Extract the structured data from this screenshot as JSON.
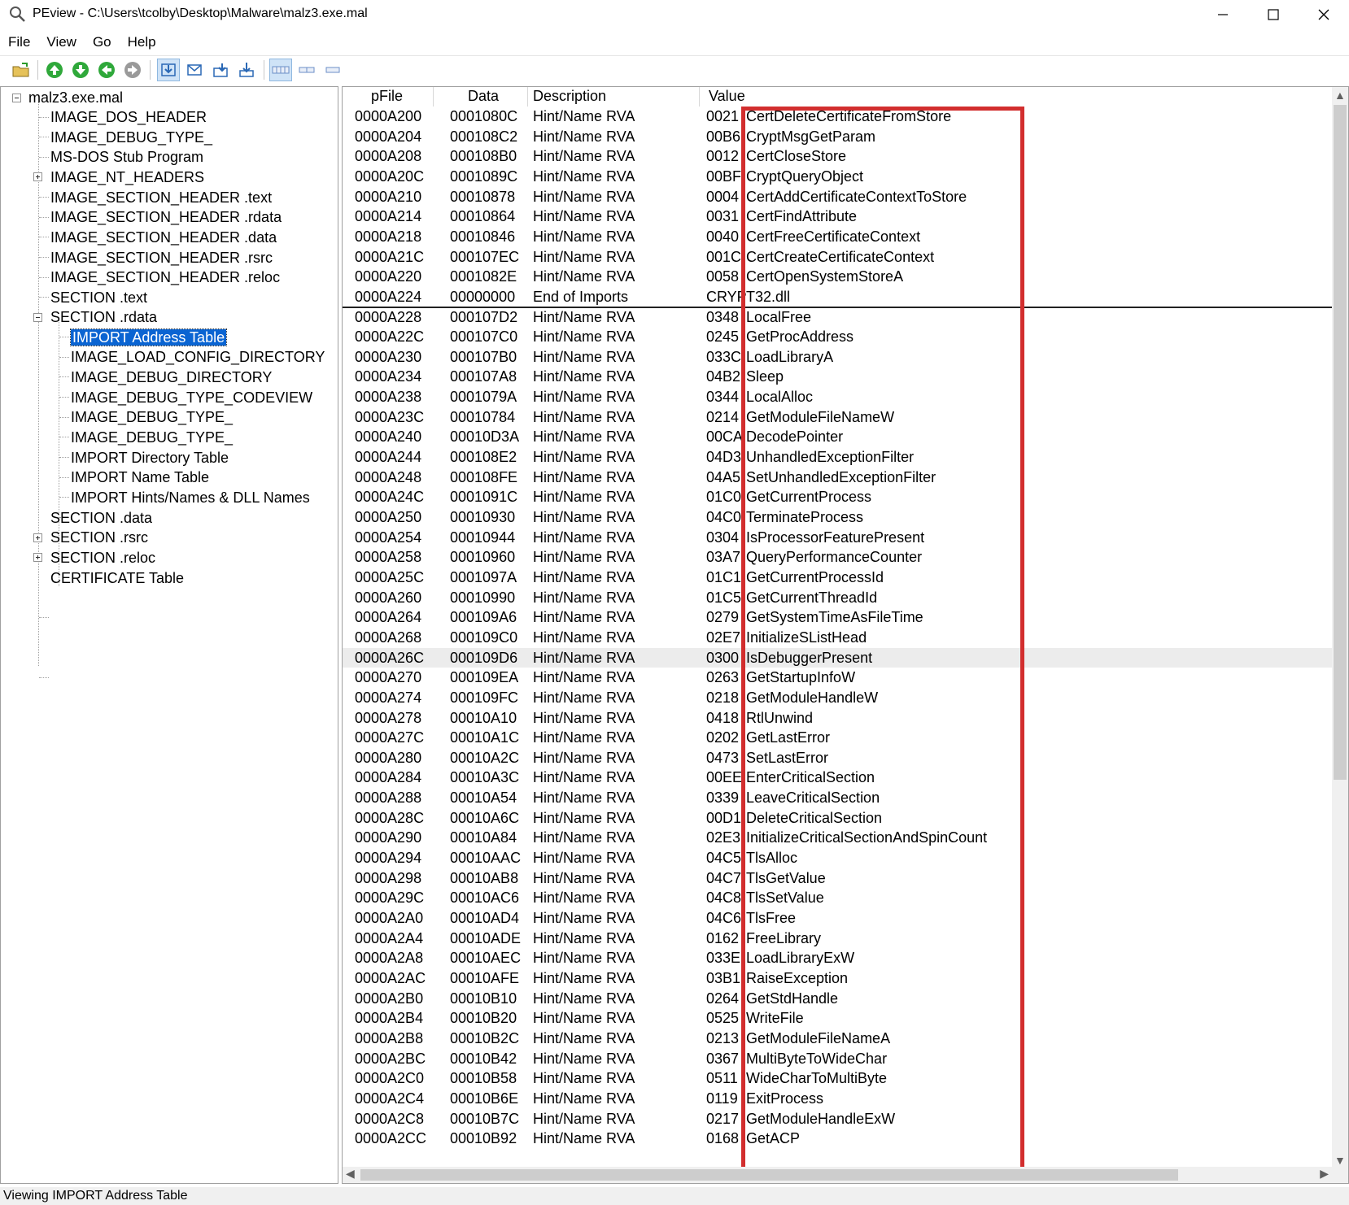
{
  "window": {
    "title": "PEview - C:\\Users\\tcolby\\Desktop\\Malware\\malz3.exe.mal"
  },
  "menu": [
    "File",
    "View",
    "Go",
    "Help"
  ],
  "tree": {
    "root": "malz3.exe.mal",
    "items": [
      "IMAGE_DOS_HEADER",
      "IMAGE_DEBUG_TYPE_",
      "MS-DOS Stub Program",
      "IMAGE_NT_HEADERS",
      "IMAGE_SECTION_HEADER .text",
      "IMAGE_SECTION_HEADER .rdata",
      "IMAGE_SECTION_HEADER .data",
      "IMAGE_SECTION_HEADER .rsrc",
      "IMAGE_SECTION_HEADER .reloc",
      "SECTION .text",
      "SECTION .rdata",
      "IMPORT Address Table",
      "IMAGE_LOAD_CONFIG_DIRECTORY",
      "IMAGE_DEBUG_DIRECTORY",
      "IMAGE_DEBUG_TYPE_CODEVIEW",
      "IMAGE_DEBUG_TYPE_",
      "IMAGE_DEBUG_TYPE_",
      "IMPORT Directory Table",
      "IMPORT Name Table",
      "IMPORT Hints/Names & DLL Names",
      "SECTION .data",
      "SECTION .rsrc",
      "SECTION .reloc",
      "CERTIFICATE Table"
    ]
  },
  "columns": [
    "pFile",
    "Data",
    "Description",
    "Value"
  ],
  "rows": [
    [
      "0000A200",
      "0001080C",
      "Hint/Name RVA",
      "0021",
      "CertDeleteCertificateFromStore"
    ],
    [
      "0000A204",
      "000108C2",
      "Hint/Name RVA",
      "00B6",
      "CryptMsgGetParam"
    ],
    [
      "0000A208",
      "000108B0",
      "Hint/Name RVA",
      "0012",
      "CertCloseStore"
    ],
    [
      "0000A20C",
      "0001089C",
      "Hint/Name RVA",
      "00BF",
      "CryptQueryObject"
    ],
    [
      "0000A210",
      "00010878",
      "Hint/Name RVA",
      "0004",
      "CertAddCertificateContextToStore"
    ],
    [
      "0000A214",
      "00010864",
      "Hint/Name RVA",
      "0031",
      "CertFindAttribute"
    ],
    [
      "0000A218",
      "00010846",
      "Hint/Name RVA",
      "0040",
      "CertFreeCertificateContext"
    ],
    [
      "0000A21C",
      "000107EC",
      "Hint/Name RVA",
      "001C",
      "CertCreateCertificateContext"
    ],
    [
      "0000A220",
      "0001082E",
      "Hint/Name RVA",
      "0058",
      "CertOpenSystemStoreA"
    ],
    [
      "0000A224",
      "00000000",
      "End of Imports",
      "CRYP",
      "T32.dll"
    ],
    [
      "0000A228",
      "000107D2",
      "Hint/Name RVA",
      "0348",
      "LocalFree"
    ],
    [
      "0000A22C",
      "000107C0",
      "Hint/Name RVA",
      "0245",
      "GetProcAddress"
    ],
    [
      "0000A230",
      "000107B0",
      "Hint/Name RVA",
      "033C",
      "LoadLibraryA"
    ],
    [
      "0000A234",
      "000107A8",
      "Hint/Name RVA",
      "04B2",
      "Sleep"
    ],
    [
      "0000A238",
      "0001079A",
      "Hint/Name RVA",
      "0344",
      "LocalAlloc"
    ],
    [
      "0000A23C",
      "00010784",
      "Hint/Name RVA",
      "0214",
      "GetModuleFileNameW"
    ],
    [
      "0000A240",
      "00010D3A",
      "Hint/Name RVA",
      "00CA",
      "DecodePointer"
    ],
    [
      "0000A244",
      "000108E2",
      "Hint/Name RVA",
      "04D3",
      "UnhandledExceptionFilter"
    ],
    [
      "0000A248",
      "000108FE",
      "Hint/Name RVA",
      "04A5",
      "SetUnhandledExceptionFilter"
    ],
    [
      "0000A24C",
      "0001091C",
      "Hint/Name RVA",
      "01C0",
      "GetCurrentProcess"
    ],
    [
      "0000A250",
      "00010930",
      "Hint/Name RVA",
      "04C0",
      "TerminateProcess"
    ],
    [
      "0000A254",
      "00010944",
      "Hint/Name RVA",
      "0304",
      "IsProcessorFeaturePresent"
    ],
    [
      "0000A258",
      "00010960",
      "Hint/Name RVA",
      "03A7",
      "QueryPerformanceCounter"
    ],
    [
      "0000A25C",
      "0001097A",
      "Hint/Name RVA",
      "01C1",
      "GetCurrentProcessId"
    ],
    [
      "0000A260",
      "00010990",
      "Hint/Name RVA",
      "01C5",
      "GetCurrentThreadId"
    ],
    [
      "0000A264",
      "000109A6",
      "Hint/Name RVA",
      "0279",
      "GetSystemTimeAsFileTime"
    ],
    [
      "0000A268",
      "000109C0",
      "Hint/Name RVA",
      "02E7",
      "InitializeSListHead"
    ],
    [
      "0000A26C",
      "000109D6",
      "Hint/Name RVA",
      "0300",
      "IsDebuggerPresent"
    ],
    [
      "0000A270",
      "000109EA",
      "Hint/Name RVA",
      "0263",
      "GetStartupInfoW"
    ],
    [
      "0000A274",
      "000109FC",
      "Hint/Name RVA",
      "0218",
      "GetModuleHandleW"
    ],
    [
      "0000A278",
      "00010A10",
      "Hint/Name RVA",
      "0418",
      "RtlUnwind"
    ],
    [
      "0000A27C",
      "00010A1C",
      "Hint/Name RVA",
      "0202",
      "GetLastError"
    ],
    [
      "0000A280",
      "00010A2C",
      "Hint/Name RVA",
      "0473",
      "SetLastError"
    ],
    [
      "0000A284",
      "00010A3C",
      "Hint/Name RVA",
      "00EE",
      "EnterCriticalSection"
    ],
    [
      "0000A288",
      "00010A54",
      "Hint/Name RVA",
      "0339",
      "LeaveCriticalSection"
    ],
    [
      "0000A28C",
      "00010A6C",
      "Hint/Name RVA",
      "00D1",
      "DeleteCriticalSection"
    ],
    [
      "0000A290",
      "00010A84",
      "Hint/Name RVA",
      "02E3",
      "InitializeCriticalSectionAndSpinCount"
    ],
    [
      "0000A294",
      "00010AAC",
      "Hint/Name RVA",
      "04C5",
      "TlsAlloc"
    ],
    [
      "0000A298",
      "00010AB8",
      "Hint/Name RVA",
      "04C7",
      "TlsGetValue"
    ],
    [
      "0000A29C",
      "00010AC6",
      "Hint/Name RVA",
      "04C8",
      "TlsSetValue"
    ],
    [
      "0000A2A0",
      "00010AD4",
      "Hint/Name RVA",
      "04C6",
      "TlsFree"
    ],
    [
      "0000A2A4",
      "00010ADE",
      "Hint/Name RVA",
      "0162",
      "FreeLibrary"
    ],
    [
      "0000A2A8",
      "00010AEC",
      "Hint/Name RVA",
      "033E",
      "LoadLibraryExW"
    ],
    [
      "0000A2AC",
      "00010AFE",
      "Hint/Name RVA",
      "03B1",
      "RaiseException"
    ],
    [
      "0000A2B0",
      "00010B10",
      "Hint/Name RVA",
      "0264",
      "GetStdHandle"
    ],
    [
      "0000A2B4",
      "00010B20",
      "Hint/Name RVA",
      "0525",
      "WriteFile"
    ],
    [
      "0000A2B8",
      "00010B2C",
      "Hint/Name RVA",
      "0213",
      "GetModuleFileNameA"
    ],
    [
      "0000A2BC",
      "00010B42",
      "Hint/Name RVA",
      "0367",
      "MultiByteToWideChar"
    ],
    [
      "0000A2C0",
      "00010B58",
      "Hint/Name RVA",
      "0511",
      "WideCharToMultiByte"
    ],
    [
      "0000A2C4",
      "00010B6E",
      "Hint/Name RVA",
      "0119",
      "ExitProcess"
    ],
    [
      "0000A2C8",
      "00010B7C",
      "Hint/Name RVA",
      "0217",
      "GetModuleHandleExW"
    ],
    [
      "0000A2CC",
      "00010B92",
      "Hint/Name RVA",
      "0168",
      "GetACP"
    ]
  ],
  "status": "Viewing IMPORT Address Table"
}
